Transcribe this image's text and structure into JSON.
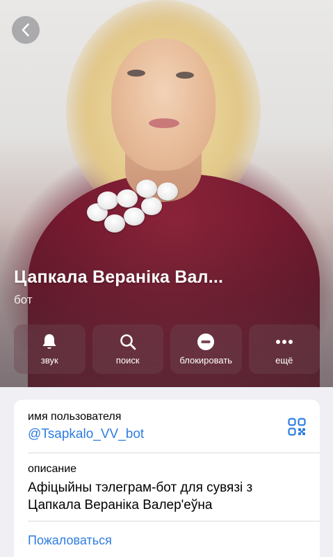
{
  "profile": {
    "name": "Цапкала Вераніка Вал...",
    "subtitle": "бот"
  },
  "actions": [
    {
      "icon": "bell-icon",
      "label": "звук"
    },
    {
      "icon": "search-icon",
      "label": "поиск"
    },
    {
      "icon": "block-icon",
      "label": "блокировать"
    },
    {
      "icon": "more-icon",
      "label": "ещё"
    }
  ],
  "info": {
    "username_label": "имя пользователя",
    "username_value": "@Tsapkalo_VV_bot",
    "description_label": "описание",
    "description_line1": "Афіцыйны тэлеграм-бот для сувязі з",
    "description_line2": "Цапкала Вераніка Валер'еўна",
    "report_label": "Пожаловаться"
  },
  "colors": {
    "accent": "#2f7de1",
    "hero_dress": "#74192f",
    "background": "#efeff4"
  }
}
